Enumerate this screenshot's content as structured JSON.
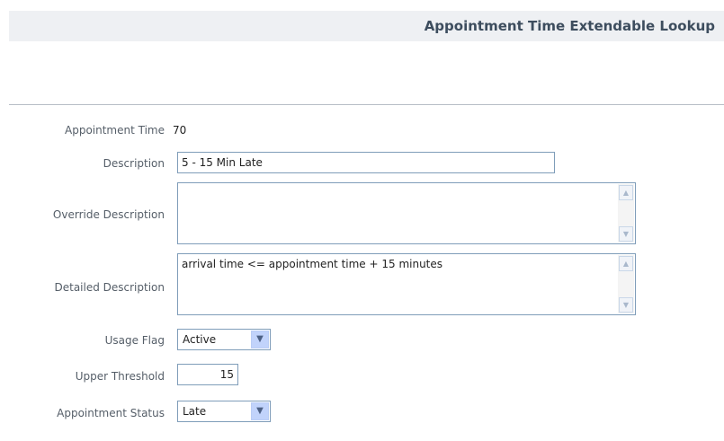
{
  "page": {
    "title": "Appointment Time Extendable Lookup"
  },
  "form": {
    "appointment_time": {
      "label": "Appointment Time",
      "value": "70"
    },
    "description": {
      "label": "Description",
      "value": "5 - 15 Min Late"
    },
    "override_description": {
      "label": "Override Description",
      "value": ""
    },
    "detailed_description": {
      "label": "Detailed Description",
      "value": "arrival time <= appointment time + 15 minutes"
    },
    "usage_flag": {
      "label": "Usage Flag",
      "value": "Active"
    },
    "upper_threshold": {
      "label": "Upper Threshold",
      "value": "15"
    },
    "appointment_status": {
      "label": "Appointment Status",
      "value": "Late"
    }
  },
  "icons": {
    "scroll_up": "chevron-up-icon",
    "scroll_down": "chevron-down-icon",
    "dropdown": "chevron-down-icon"
  },
  "colors": {
    "title_text": "#3d4d5e",
    "title_bar": "#eef0f3",
    "field_border": "#7f9db9",
    "dropdown_button": "#c1d3fb"
  }
}
